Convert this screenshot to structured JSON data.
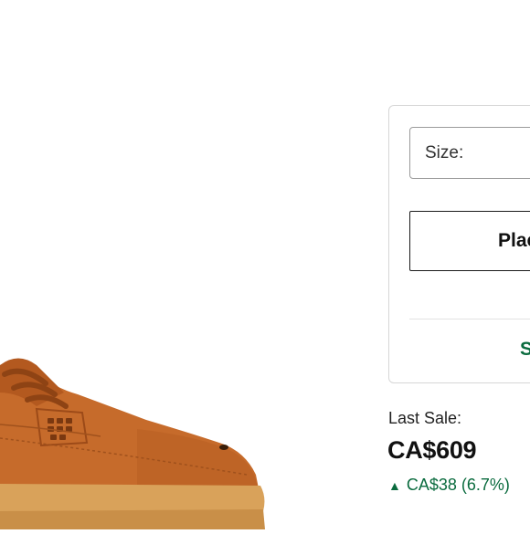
{
  "product": {
    "image_alt": "Brown leather sneaker"
  },
  "buy_box": {
    "size_label": "Size:",
    "place_button_label": "Plac",
    "sell_link_label": "S"
  },
  "market": {
    "last_sale_label": "Last Sale:",
    "last_sale_price": "CA$609",
    "change_arrow": "▲",
    "change_text": "CA$38 (6.7%)",
    "change_color": "#0a6b3e"
  },
  "colors": {
    "accent_green": "#0a6b3e",
    "shoe_leather": "#c4692a",
    "sole_gum": "#d9a25a"
  }
}
